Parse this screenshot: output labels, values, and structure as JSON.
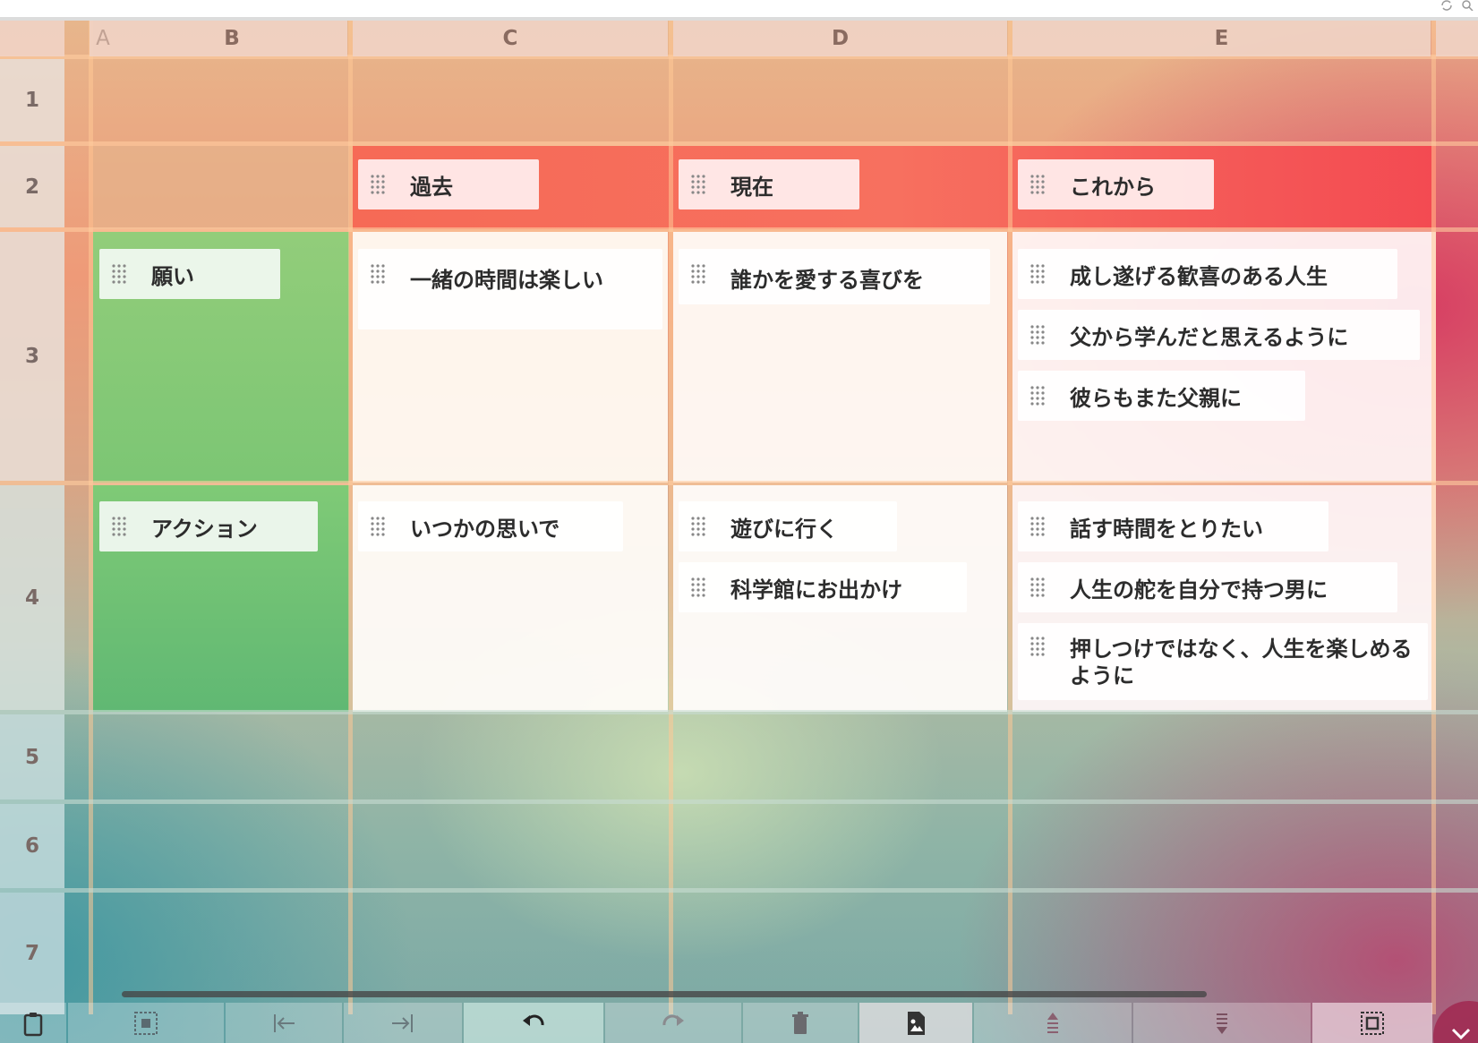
{
  "columns": {
    "a": "A",
    "b": "B",
    "c": "C",
    "d": "D",
    "e": "E"
  },
  "rows": [
    "1",
    "2",
    "3",
    "4",
    "5",
    "6",
    "7"
  ],
  "headers": {
    "past": "過去",
    "present": "現在",
    "future": "これから"
  },
  "row_labels": {
    "wish": "願い",
    "action": "アクション"
  },
  "cards": {
    "c3": [
      "一緒の時間は楽しい"
    ],
    "d3": [
      "誰かを愛する喜びを"
    ],
    "e3": [
      "成し遂げる歓喜のある人生",
      "父から学んだと思えるように",
      "彼らもまた父親に"
    ],
    "c4": [
      "いつかの思いで"
    ],
    "d4": [
      "遊びに行く",
      "科学館にお出かけ"
    ],
    "e4": [
      "話す時間をとりたい",
      "人生の舵を自分で持つ男に",
      "押しつけではなく、人生を楽しめるように"
    ]
  },
  "toolbar_icons": [
    "clipboard-icon",
    "select-grid-icon",
    "indent-left-icon",
    "indent-right-icon",
    "undo-icon",
    "redo-icon",
    "trash-icon",
    "image-file-icon",
    "move-up-icon",
    "move-down-icon",
    "frame-select-icon",
    "chevron-down-icon"
  ],
  "colors": {
    "header_row": "#f4655a",
    "wish_green": "#86c87a",
    "card_bg": "#ffffff"
  }
}
